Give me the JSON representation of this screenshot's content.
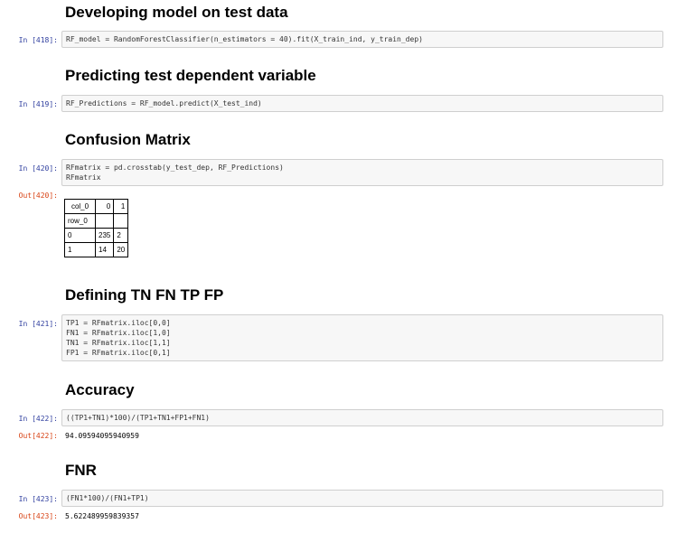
{
  "cells": [
    {
      "heading": "Developing model on test data",
      "prompt": "In [418]:",
      "code": [
        "RF_model = RandomForestClassifier(n_estimators = 40).fit(X_train_ind, y_train_dep)"
      ]
    },
    {
      "heading": "Predicting test dependent variable",
      "prompt": "In [419]:",
      "code": [
        "RF_Predictions = RF_model.predict(X_test_ind)"
      ]
    },
    {
      "heading": "Confusion Matrix",
      "prompt": "In [420]:",
      "code": [
        "RFmatrix = pd.crosstab(y_test_dep, RF_Predictions)",
        "RFmatrix"
      ],
      "out_prompt": "Out[420]:",
      "table": {
        "corner_label": "col_0",
        "col_headers": [
          "0",
          "1"
        ],
        "index_name": "row_0",
        "rows": [
          {
            "index": "0",
            "values": [
              "235",
              "2"
            ]
          },
          {
            "index": "1",
            "values": [
              "14",
              "20"
            ]
          }
        ]
      }
    },
    {
      "heading": "Defining TN FN TP FP",
      "prompt": "In [421]:",
      "code": [
        "TP1 = RFmatrix.iloc[0,0]",
        "FN1 = RFmatrix.iloc[1,0]",
        "TN1 = RFmatrix.iloc[1,1]",
        "FP1 = RFmatrix.iloc[0,1]"
      ]
    },
    {
      "heading": "Accuracy",
      "prompt": "In [422]:",
      "code": [
        "((TP1+TN1)*100)/(TP1+TN1+FP1+FN1)"
      ],
      "out_prompt": "Out[422]:",
      "output": "94.09594095940959"
    },
    {
      "heading": "FNR",
      "prompt": "In [423]:",
      "code": [
        "(FN1*100)/(FN1+TP1)"
      ],
      "out_prompt": "Out[423]:",
      "output": "5.622489959839357"
    }
  ]
}
